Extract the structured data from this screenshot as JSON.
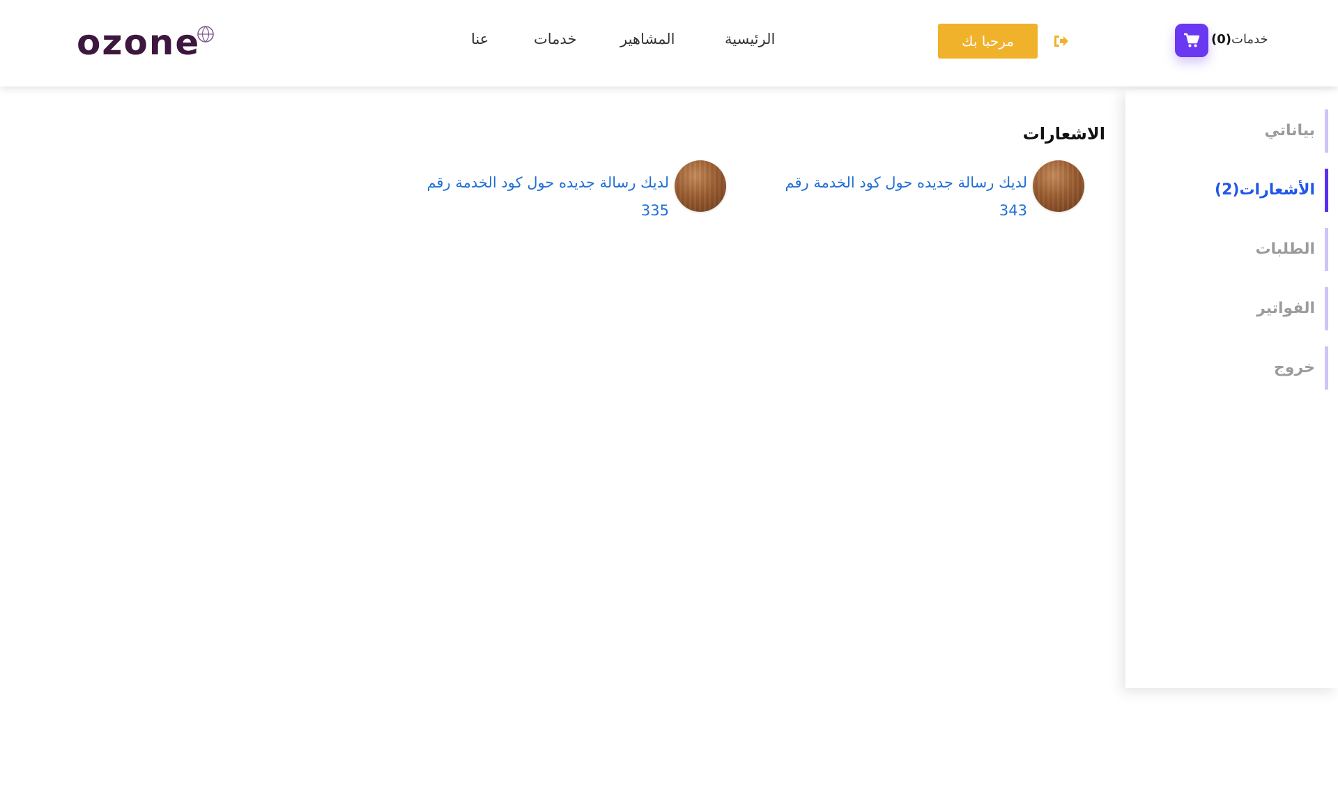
{
  "brand": {
    "logo_text": "ozone"
  },
  "nav": {
    "home": "الرئيسية",
    "celebrities": "المشاهير",
    "services": "خدمات",
    "about": "عنا"
  },
  "header": {
    "welcome_button": "مرحبا بك",
    "cart_label": "خدمات",
    "cart_count": "(0)",
    "accent_color": "#f0b12b",
    "cart_color": "#6a38f0"
  },
  "sidebar": {
    "items": [
      {
        "label": "بياناتي"
      },
      {
        "label": "الأشعارات(2)"
      },
      {
        "label": "الطلبات"
      },
      {
        "label": "الفواتير"
      },
      {
        "label": "خروج"
      }
    ],
    "active_index": 1,
    "active_color": "#1f57e7"
  },
  "main": {
    "title": "الاشعارات",
    "notifications": [
      {
        "text": "لديك رسالة جديده حول كود الخدمة رقم 343"
      },
      {
        "text": "لديك رسالة جديده حول كود الخدمة رقم 335"
      }
    ]
  }
}
